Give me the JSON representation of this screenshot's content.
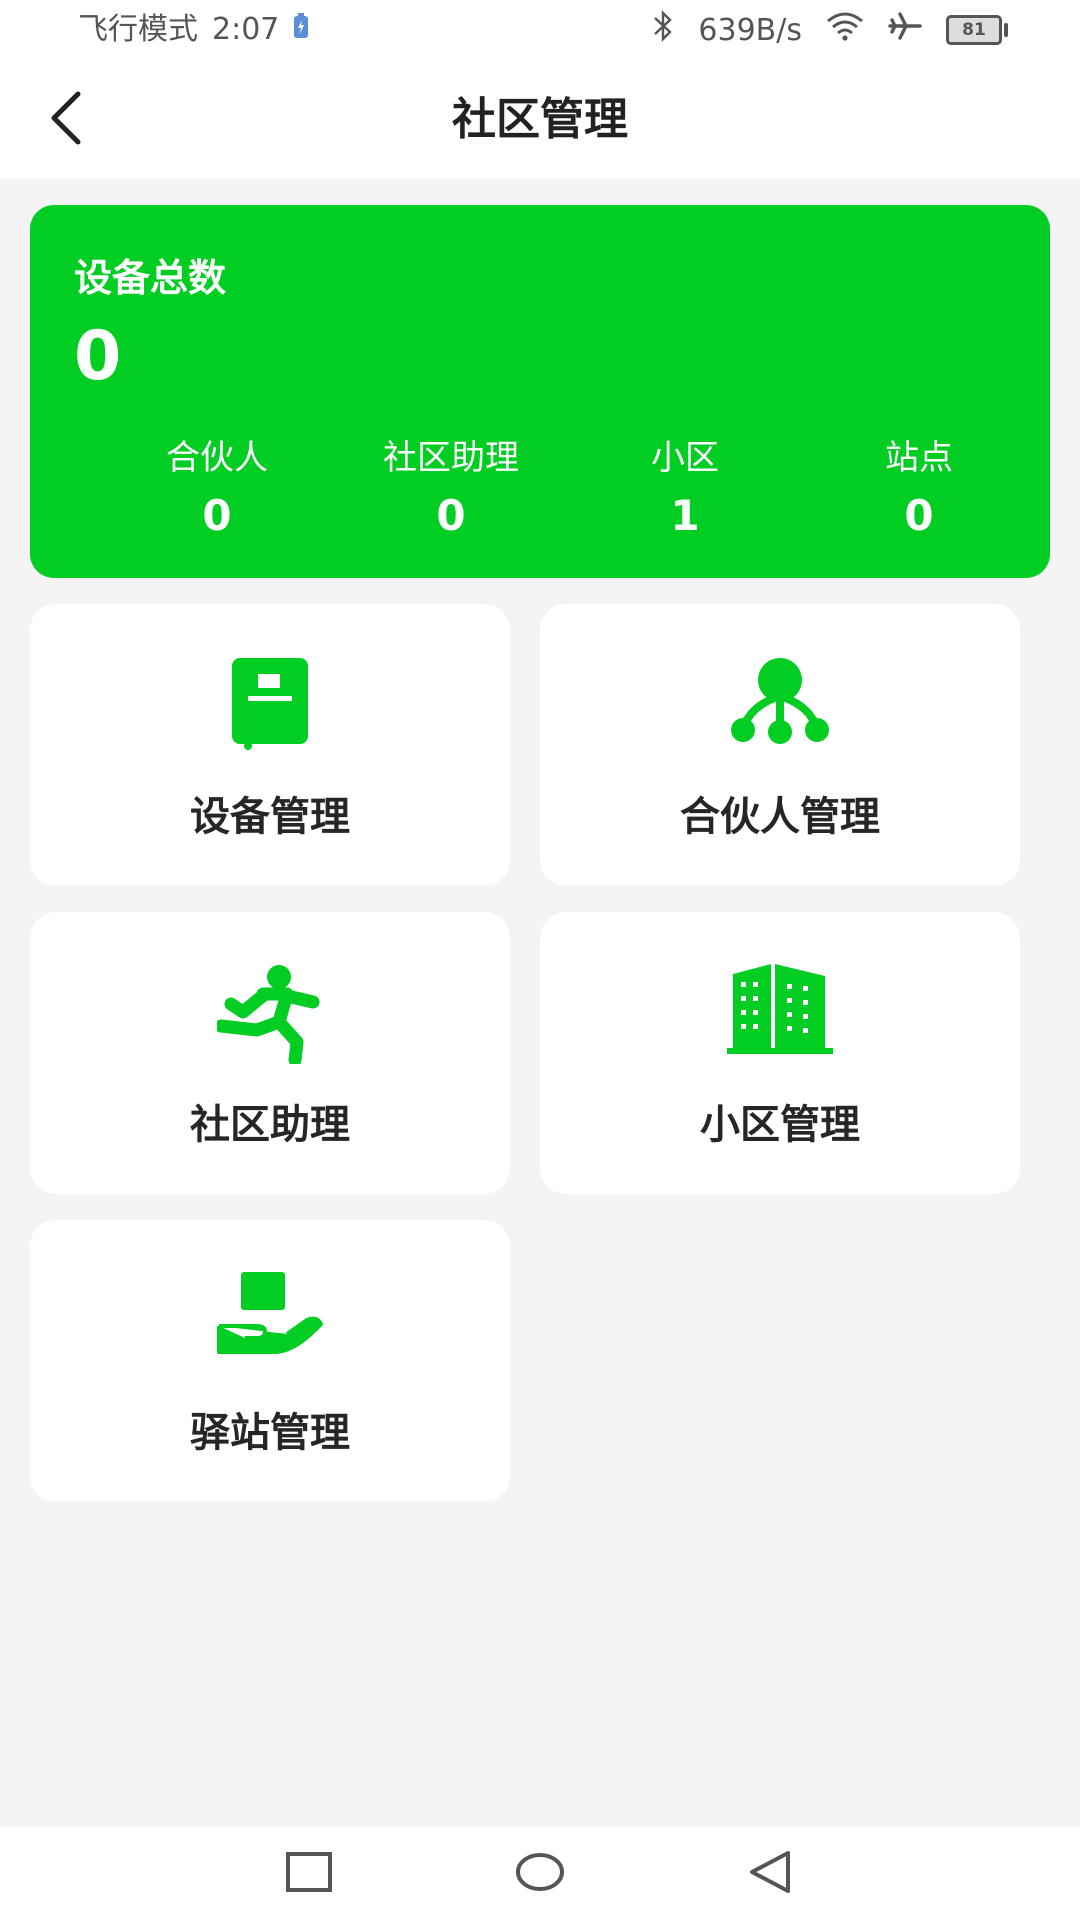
{
  "status": {
    "mode": "飞行模式",
    "time": "2:07",
    "speed": "639B/s",
    "battery": "81"
  },
  "header": {
    "title": "社区管理",
    "back_icon": "chevron-left-icon"
  },
  "summary": {
    "label": "设备总数",
    "total": "0",
    "stats": [
      {
        "label": "合伙人",
        "value": "0"
      },
      {
        "label": "社区助理",
        "value": "0"
      },
      {
        "label": "小区",
        "value": "1"
      },
      {
        "label": "站点",
        "value": "0"
      }
    ],
    "color": "#02cd22"
  },
  "tiles": [
    {
      "label": "设备管理",
      "icon": "device-icon"
    },
    {
      "label": "合伙人管理",
      "icon": "partner-network-icon"
    },
    {
      "label": "社区助理",
      "icon": "running-person-icon"
    },
    {
      "label": "小区管理",
      "icon": "building-icon"
    },
    {
      "label": "驿站管理",
      "icon": "package-hand-icon"
    }
  ],
  "accent_color": "#02cd22"
}
